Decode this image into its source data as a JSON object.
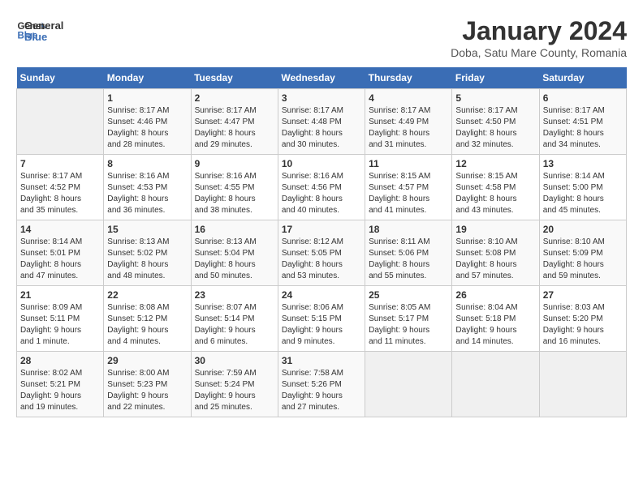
{
  "header": {
    "logo_line1": "General",
    "logo_line2": "Blue",
    "title": "January 2024",
    "subtitle": "Doba, Satu Mare County, Romania"
  },
  "days_of_week": [
    "Sunday",
    "Monday",
    "Tuesday",
    "Wednesday",
    "Thursday",
    "Friday",
    "Saturday"
  ],
  "weeks": [
    [
      {
        "day": "",
        "info": ""
      },
      {
        "day": "1",
        "info": "Sunrise: 8:17 AM\nSunset: 4:46 PM\nDaylight: 8 hours\nand 28 minutes."
      },
      {
        "day": "2",
        "info": "Sunrise: 8:17 AM\nSunset: 4:47 PM\nDaylight: 8 hours\nand 29 minutes."
      },
      {
        "day": "3",
        "info": "Sunrise: 8:17 AM\nSunset: 4:48 PM\nDaylight: 8 hours\nand 30 minutes."
      },
      {
        "day": "4",
        "info": "Sunrise: 8:17 AM\nSunset: 4:49 PM\nDaylight: 8 hours\nand 31 minutes."
      },
      {
        "day": "5",
        "info": "Sunrise: 8:17 AM\nSunset: 4:50 PM\nDaylight: 8 hours\nand 32 minutes."
      },
      {
        "day": "6",
        "info": "Sunrise: 8:17 AM\nSunset: 4:51 PM\nDaylight: 8 hours\nand 34 minutes."
      }
    ],
    [
      {
        "day": "7",
        "info": "Sunrise: 8:17 AM\nSunset: 4:52 PM\nDaylight: 8 hours\nand 35 minutes."
      },
      {
        "day": "8",
        "info": "Sunrise: 8:16 AM\nSunset: 4:53 PM\nDaylight: 8 hours\nand 36 minutes."
      },
      {
        "day": "9",
        "info": "Sunrise: 8:16 AM\nSunset: 4:55 PM\nDaylight: 8 hours\nand 38 minutes."
      },
      {
        "day": "10",
        "info": "Sunrise: 8:16 AM\nSunset: 4:56 PM\nDaylight: 8 hours\nand 40 minutes."
      },
      {
        "day": "11",
        "info": "Sunrise: 8:15 AM\nSunset: 4:57 PM\nDaylight: 8 hours\nand 41 minutes."
      },
      {
        "day": "12",
        "info": "Sunrise: 8:15 AM\nSunset: 4:58 PM\nDaylight: 8 hours\nand 43 minutes."
      },
      {
        "day": "13",
        "info": "Sunrise: 8:14 AM\nSunset: 5:00 PM\nDaylight: 8 hours\nand 45 minutes."
      }
    ],
    [
      {
        "day": "14",
        "info": "Sunrise: 8:14 AM\nSunset: 5:01 PM\nDaylight: 8 hours\nand 47 minutes."
      },
      {
        "day": "15",
        "info": "Sunrise: 8:13 AM\nSunset: 5:02 PM\nDaylight: 8 hours\nand 48 minutes."
      },
      {
        "day": "16",
        "info": "Sunrise: 8:13 AM\nSunset: 5:04 PM\nDaylight: 8 hours\nand 50 minutes."
      },
      {
        "day": "17",
        "info": "Sunrise: 8:12 AM\nSunset: 5:05 PM\nDaylight: 8 hours\nand 53 minutes."
      },
      {
        "day": "18",
        "info": "Sunrise: 8:11 AM\nSunset: 5:06 PM\nDaylight: 8 hours\nand 55 minutes."
      },
      {
        "day": "19",
        "info": "Sunrise: 8:10 AM\nSunset: 5:08 PM\nDaylight: 8 hours\nand 57 minutes."
      },
      {
        "day": "20",
        "info": "Sunrise: 8:10 AM\nSunset: 5:09 PM\nDaylight: 8 hours\nand 59 minutes."
      }
    ],
    [
      {
        "day": "21",
        "info": "Sunrise: 8:09 AM\nSunset: 5:11 PM\nDaylight: 9 hours\nand 1 minute."
      },
      {
        "day": "22",
        "info": "Sunrise: 8:08 AM\nSunset: 5:12 PM\nDaylight: 9 hours\nand 4 minutes."
      },
      {
        "day": "23",
        "info": "Sunrise: 8:07 AM\nSunset: 5:14 PM\nDaylight: 9 hours\nand 6 minutes."
      },
      {
        "day": "24",
        "info": "Sunrise: 8:06 AM\nSunset: 5:15 PM\nDaylight: 9 hours\nand 9 minutes."
      },
      {
        "day": "25",
        "info": "Sunrise: 8:05 AM\nSunset: 5:17 PM\nDaylight: 9 hours\nand 11 minutes."
      },
      {
        "day": "26",
        "info": "Sunrise: 8:04 AM\nSunset: 5:18 PM\nDaylight: 9 hours\nand 14 minutes."
      },
      {
        "day": "27",
        "info": "Sunrise: 8:03 AM\nSunset: 5:20 PM\nDaylight: 9 hours\nand 16 minutes."
      }
    ],
    [
      {
        "day": "28",
        "info": "Sunrise: 8:02 AM\nSunset: 5:21 PM\nDaylight: 9 hours\nand 19 minutes."
      },
      {
        "day": "29",
        "info": "Sunrise: 8:00 AM\nSunset: 5:23 PM\nDaylight: 9 hours\nand 22 minutes."
      },
      {
        "day": "30",
        "info": "Sunrise: 7:59 AM\nSunset: 5:24 PM\nDaylight: 9 hours\nand 25 minutes."
      },
      {
        "day": "31",
        "info": "Sunrise: 7:58 AM\nSunset: 5:26 PM\nDaylight: 9 hours\nand 27 minutes."
      },
      {
        "day": "",
        "info": ""
      },
      {
        "day": "",
        "info": ""
      },
      {
        "day": "",
        "info": ""
      }
    ]
  ]
}
